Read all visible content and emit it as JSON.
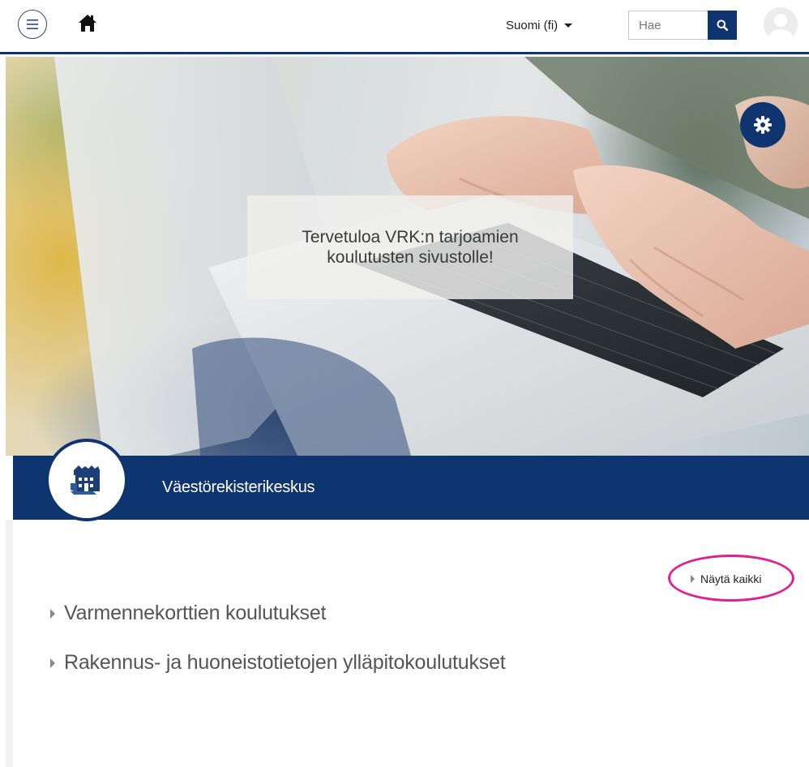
{
  "header": {
    "language": {
      "label": "Suomi (fi)"
    },
    "search": {
      "placeholder": "Hae"
    }
  },
  "hero": {
    "welcome_lines": [
      "Tervetuloa VRK:n tarjoamien",
      "koulutusten sivustolle!"
    ]
  },
  "organization": {
    "title": "Väestörekisterikeskus"
  },
  "content": {
    "show_all_label": "Näytä kaikki",
    "categories": [
      {
        "label": "Varmennekorttien koulutukset"
      },
      {
        "label": "Rakennus- ja huoneistotietojen ylläpitokoulutukset"
      }
    ]
  },
  "colors": {
    "brand_navy": "#0f3570",
    "highlight_magenta": "#e0208f"
  },
  "icons": [
    "menu-icon",
    "home-icon",
    "chevron-down-icon",
    "search-icon",
    "avatar-icon",
    "gear-icon",
    "organization-logo-icon",
    "caret-right-icon"
  ]
}
